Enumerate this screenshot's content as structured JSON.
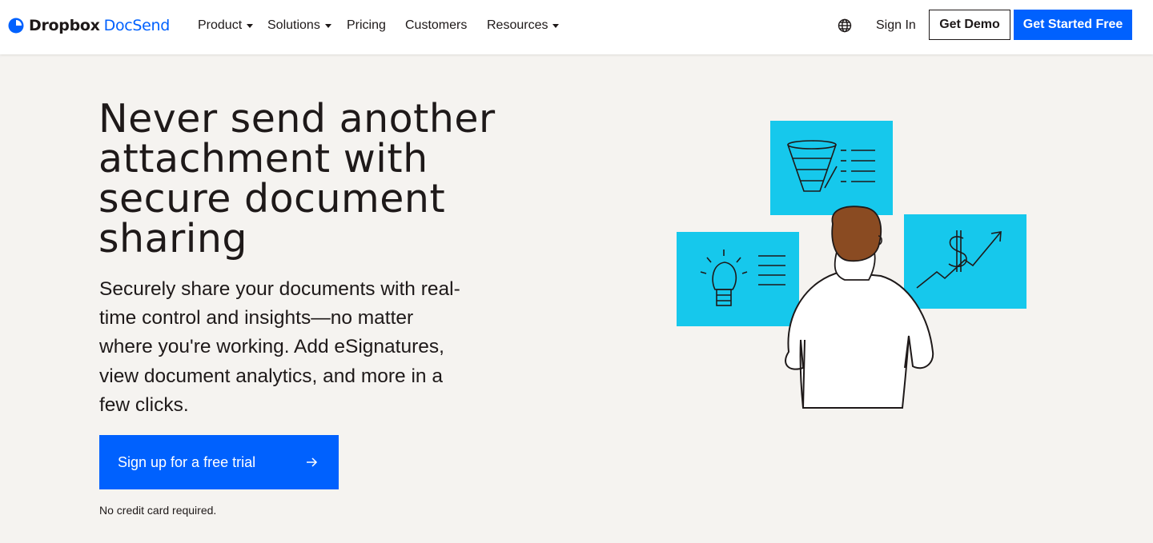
{
  "nav": {
    "logo": {
      "brand": "Dropbox",
      "product": "DocSend"
    },
    "items": [
      {
        "label": "Product",
        "has_dropdown": true
      },
      {
        "label": "Solutions",
        "has_dropdown": true
      },
      {
        "label": "Pricing",
        "has_dropdown": false
      },
      {
        "label": "Customers",
        "has_dropdown": false
      },
      {
        "label": "Resources",
        "has_dropdown": true
      }
    ],
    "globe_icon": "globe-icon",
    "sign_in": "Sign In",
    "get_demo": "Get Demo",
    "get_started": "Get Started Free"
  },
  "hero": {
    "headline_lines": [
      "Never send another",
      "attachment with",
      "secure document",
      "sharing"
    ],
    "subtext_lines": [
      "Securely share your documents with real-",
      "time control and insights—no matter",
      "where you're working. Add eSignatures,",
      "view document analytics, and more in a",
      "few clicks."
    ],
    "cta_label": "Sign up for a free trial",
    "cta_icon": "arrow-right-icon",
    "note": "No credit card required."
  },
  "illustration": {
    "description_icons": [
      "funnel-icon",
      "lightbulb-icon",
      "dollar-chart-icon"
    ]
  },
  "colors": {
    "accent": "#0061fe",
    "background": "#f5f3f0",
    "text": "#1e1919",
    "panel": "#16c8ec",
    "hair": "#8a4b22"
  }
}
